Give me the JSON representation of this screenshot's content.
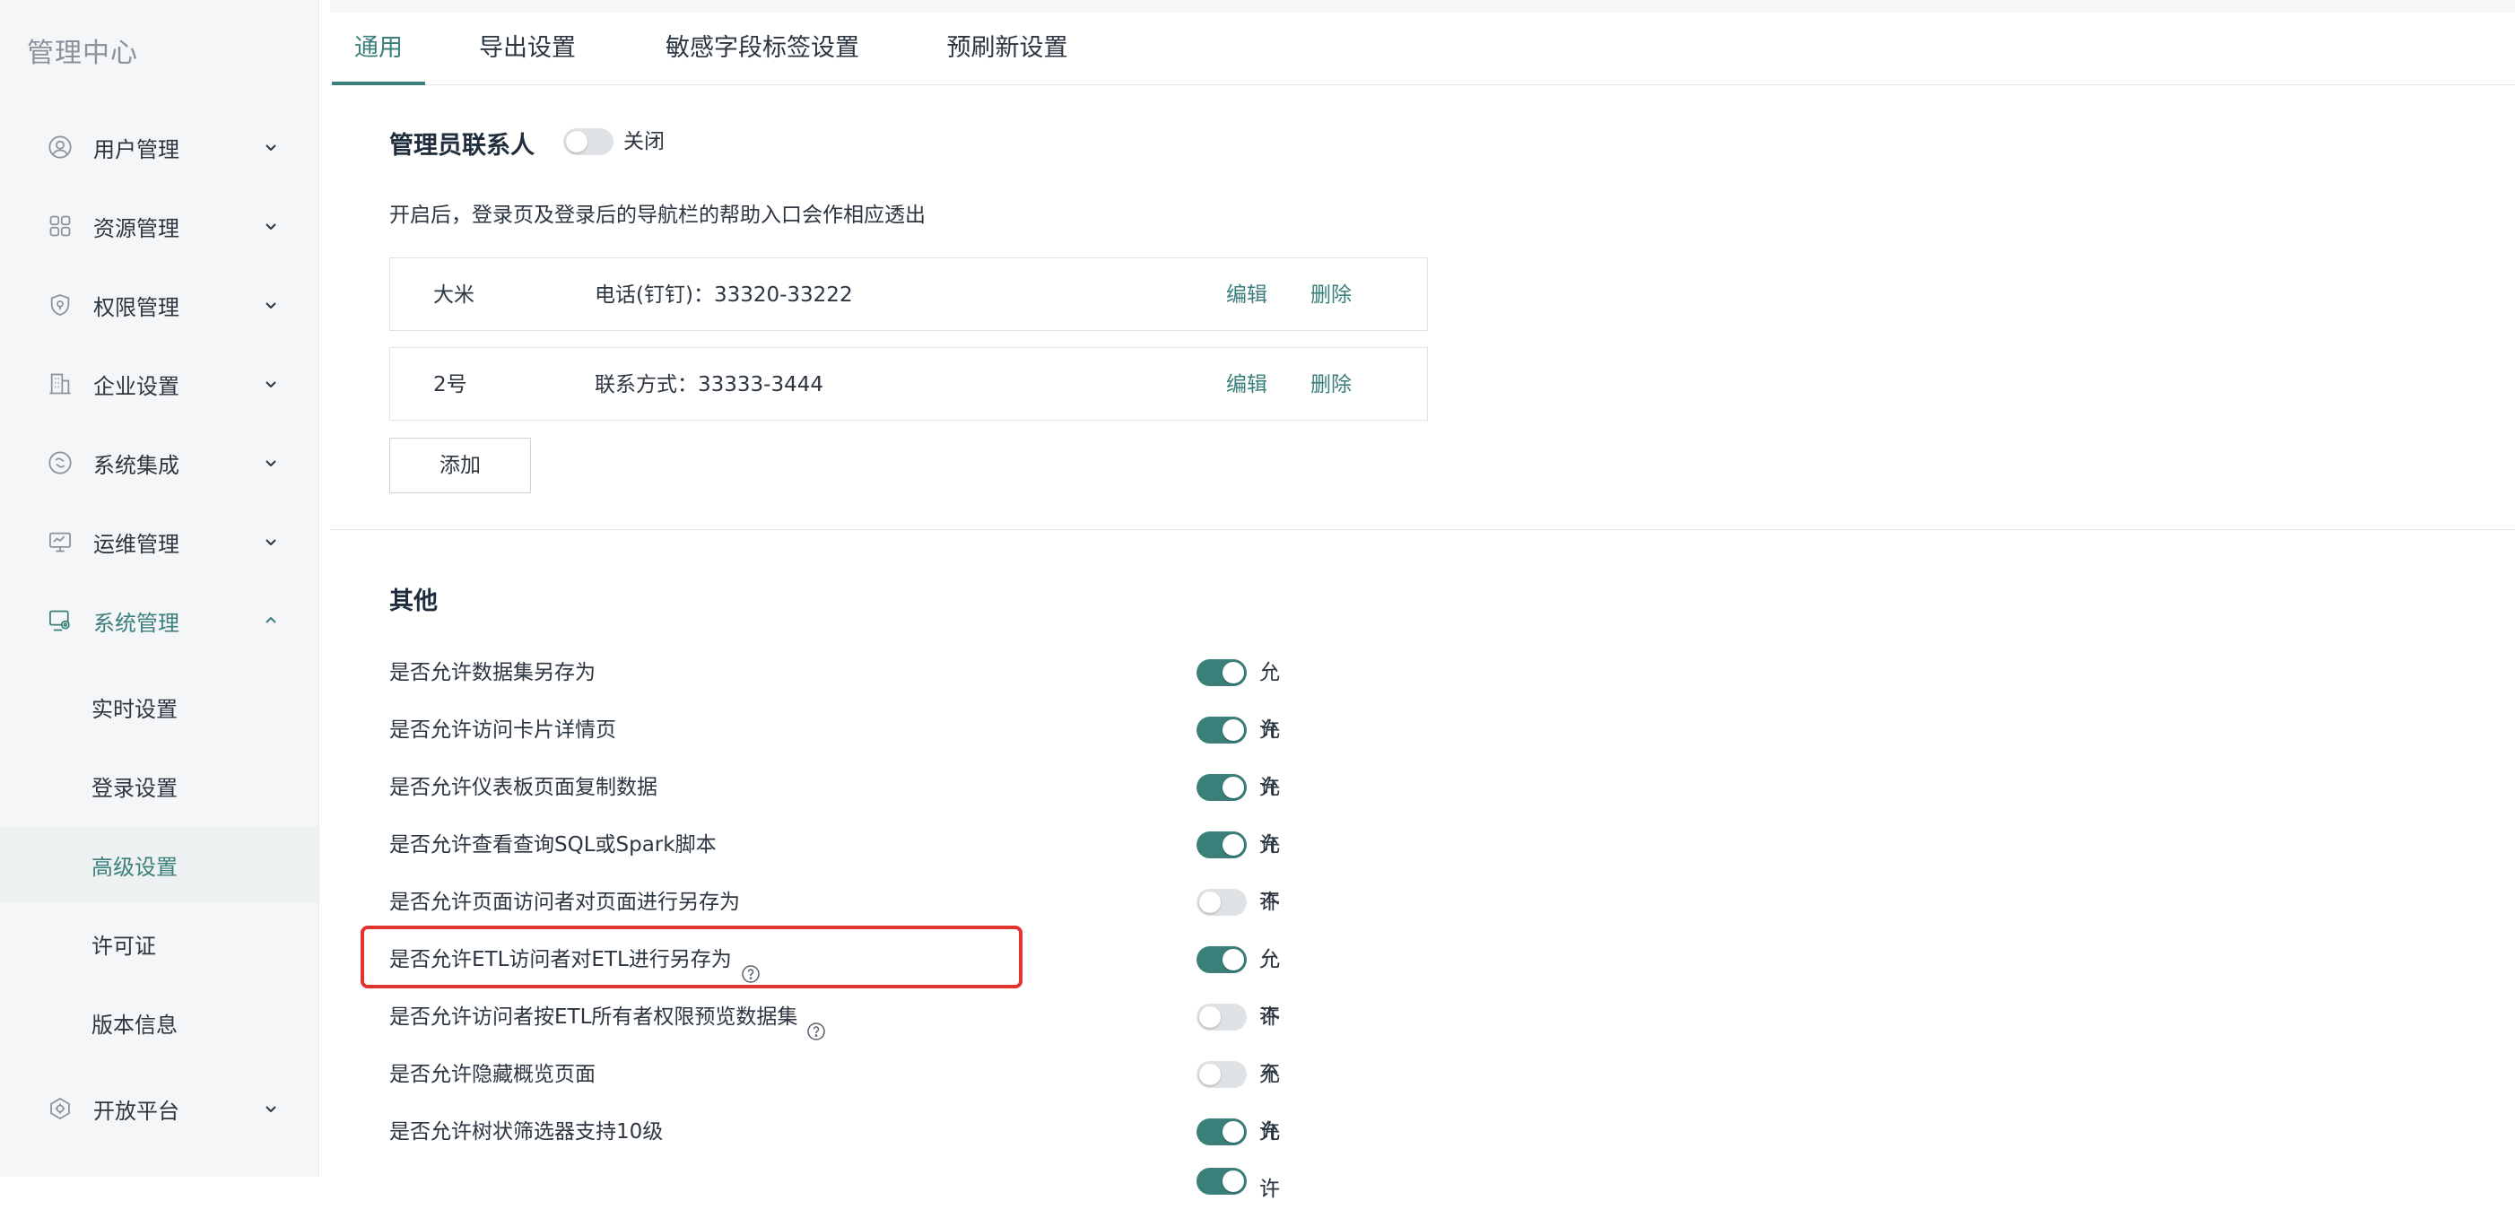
{
  "sidebar": {
    "title": "管理中心",
    "items": [
      {
        "label": "用户管理",
        "icon": "user-circle-icon"
      },
      {
        "label": "资源管理",
        "icon": "grid-apps-icon"
      },
      {
        "label": "权限管理",
        "icon": "shield-icon"
      },
      {
        "label": "企业设置",
        "icon": "building-icon"
      },
      {
        "label": "系统集成",
        "icon": "integration-icon"
      },
      {
        "label": "运维管理",
        "icon": "monitor-icon"
      },
      {
        "label": "系统管理",
        "icon": "system-settings-icon"
      },
      {
        "label": "开放平台",
        "icon": "open-platform-icon"
      }
    ],
    "sub_items": [
      {
        "label": "实时设置"
      },
      {
        "label": "登录设置"
      },
      {
        "label": "高级设置"
      },
      {
        "label": "许可证"
      },
      {
        "label": "版本信息"
      }
    ],
    "active_item": "系统管理",
    "selected_sub_item": "高级设置"
  },
  "tabs": [
    {
      "label": "通用"
    },
    {
      "label": "导出设置"
    },
    {
      "label": "敏感字段标签设置"
    },
    {
      "label": "预刷新设置"
    }
  ],
  "active_tab": "通用",
  "admin_contact": {
    "title": "管理员联系人",
    "toggle_on": false,
    "toggle_text": "关闭",
    "description": "开启后，登录页及登录后的导航栏的帮助入口会作相应透出",
    "contacts": [
      {
        "name": "大米",
        "info": "电话(钉钉)：33320-33222",
        "edit": "编辑",
        "delete": "删除"
      },
      {
        "name": "2号",
        "info": "联系方式：33333-3444",
        "edit": "编辑",
        "delete": "删除"
      }
    ],
    "add_label": "添加"
  },
  "other": {
    "title": "其他",
    "settings": [
      {
        "label": "是否允许数据集另存为",
        "on": true,
        "status": "允许",
        "help": false
      },
      {
        "label": "是否允许访问卡片详情页",
        "on": true,
        "status": "允许",
        "help": false
      },
      {
        "label": "是否允许仪表板页面复制数据",
        "on": true,
        "status": "允许",
        "help": false
      },
      {
        "label": "是否允许查看查询SQL或Spark脚本",
        "on": true,
        "status": "允许",
        "help": false
      },
      {
        "label": "是否允许页面访问者对页面进行另存为",
        "on": false,
        "status": "不允许",
        "help": false
      },
      {
        "label": "是否允许ETL访问者对ETL进行另存为",
        "on": true,
        "status": "允许",
        "help": true
      },
      {
        "label": "是否允许访问者按ETL所有者权限预览数据集",
        "on": false,
        "status": "不允许",
        "help": true
      },
      {
        "label": "是否允许隐藏概览页面",
        "on": false,
        "status": "不允许",
        "help": false
      },
      {
        "label": "是否允许树状筛选器支持10级",
        "on": true,
        "status": "允许",
        "help": false
      }
    ]
  },
  "colors": {
    "accent": "#3a7f7a",
    "highlight": "#e0342f",
    "toggle_off": "#dfe2e5",
    "sidebar_bg": "#f4f6f8"
  }
}
